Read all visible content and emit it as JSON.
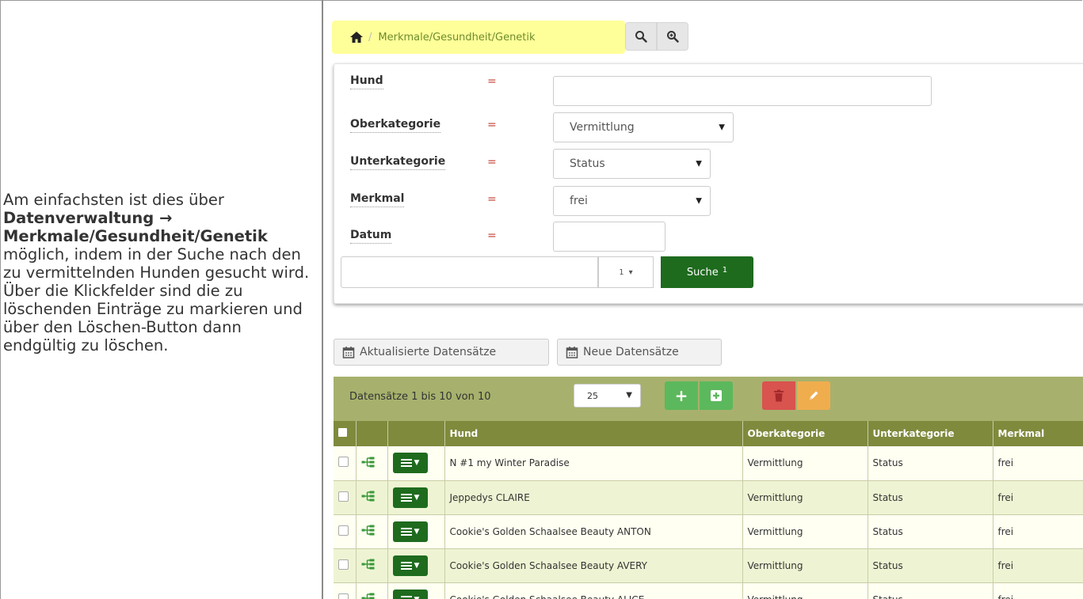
{
  "description": {
    "intro": "Am einfachsten ist dies über",
    "path": "Datenverwaltung → Merkmale/Gesundheit/Genetik",
    "rest": "möglich, indem in der Suche nach den zu vermittelnden Hunden gesucht wird. Über die Klickfelder sind die zu löschenden Einträge zu markieren und über den Löschen-Button dann endgültig zu löschen."
  },
  "breadcrumb": {
    "separator": "/",
    "title": "Merkmale/Gesundheit/Genetik"
  },
  "filters": [
    {
      "label": "Hund",
      "op": "=",
      "value": ""
    },
    {
      "label": "Oberkategorie",
      "op": "=",
      "value": "Vermittlung"
    },
    {
      "label": "Unterkategorie",
      "op": "=",
      "value": "Status"
    },
    {
      "label": "Merkmal",
      "op": "=",
      "value": "frei"
    },
    {
      "label": "Datum",
      "op": "=",
      "value": ""
    }
  ],
  "search": {
    "count": "1",
    "button_label": "Suche",
    "button_badge": "1"
  },
  "toolbar": {
    "updated_label": "Aktualisierte Datensätze",
    "new_label": "Neue Datensätze"
  },
  "grid": {
    "info": "Datensätze 1 bis 10 von 10",
    "page_size": "25",
    "columns": [
      "Hund",
      "Oberkategorie",
      "Unterkategorie",
      "Merkmal"
    ],
    "rows": [
      {
        "hund": "N #1 my Winter Paradise",
        "ober": "Vermittlung",
        "unter": "Status",
        "merkmal": "frei"
      },
      {
        "hund": "Jeppedys CLAIRE",
        "ober": "Vermittlung",
        "unter": "Status",
        "merkmal": "frei"
      },
      {
        "hund": "Cookie's Golden Schaalsee Beauty ANTON",
        "ober": "Vermittlung",
        "unter": "Status",
        "merkmal": "frei"
      },
      {
        "hund": "Cookie's Golden Schaalsee Beauty AVERY",
        "ober": "Vermittlung",
        "unter": "Status",
        "merkmal": "frei"
      },
      {
        "hund": "Cookie's Golden Schaalsee Beauty ALICE",
        "ober": "Vermittlung",
        "unter": "Status",
        "merkmal": "frei"
      }
    ]
  },
  "colors": {
    "breadcrumb_bg": "#ffff99",
    "primary_green": "#1e6b1e",
    "add_green": "#5cb85c",
    "danger_red": "#d9534f",
    "edit_orange": "#f0ad4e",
    "grid_header": "#7f8a3d",
    "grid_bar": "#a7b16d"
  },
  "icons": [
    "home-icon",
    "search-icon",
    "zoom-in-icon",
    "calendar-icon",
    "plus-icon",
    "plus-square-icon",
    "trash-icon",
    "pencil-icon",
    "sitemap-icon",
    "menu-icon"
  ]
}
